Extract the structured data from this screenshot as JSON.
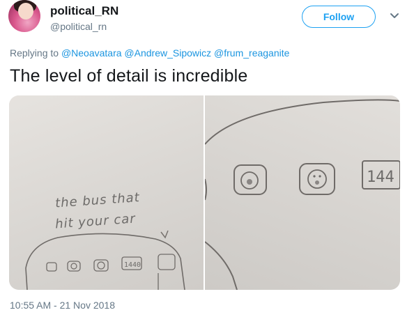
{
  "author": {
    "name": "political_RN",
    "handle": "@political_rn",
    "avatar_icon": "profile-photo"
  },
  "actions": {
    "follow_label": "Follow",
    "more_icon": "chevron-down-icon"
  },
  "reply": {
    "prefix": "Replying to",
    "mentions": [
      "@Neoavatara",
      "@Andrew_Sipowicz",
      "@frum_reaganite"
    ]
  },
  "tweet": {
    "text": "The level of detail is incredible",
    "timestamp": "10:55 AM - 21 Nov 2018"
  },
  "media": {
    "left_photo": {
      "caption_line1": "the bus that",
      "caption_line2": "hit your car",
      "plate_text": "1440"
    },
    "right_photo": {
      "plate_text": "144"
    }
  },
  "colors": {
    "accent": "#1da1f2",
    "mention": "#1b95e0",
    "secondary_text": "#657786",
    "primary_text": "#14171a",
    "pencil": "#6d6b69"
  }
}
